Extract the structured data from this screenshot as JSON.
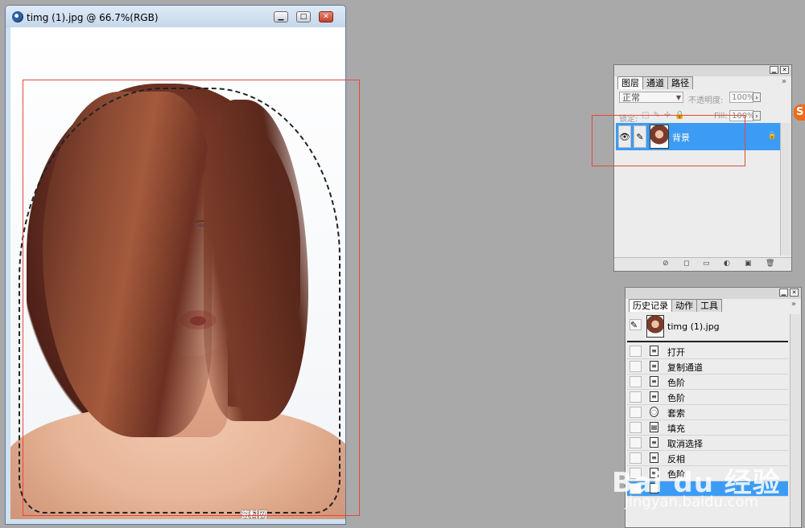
{
  "document": {
    "title": "timg (1).jpg @ 66.7%(RGB)",
    "minimize": "▁",
    "maximize": "□",
    "close": "✕",
    "watermark": "资料网 www.jutmg.com"
  },
  "layers_panel": {
    "tabs": [
      "图层",
      "通道",
      "路径"
    ],
    "blend_mode": "正常",
    "opacity_label": "不透明度:",
    "opacity_value": "100%",
    "lock_label": "锁定:",
    "fill_label": "Fill:",
    "fill_value": "100%",
    "layer_name": "背景"
  },
  "history_panel": {
    "tabs": [
      "历史记录",
      "动作",
      "工具"
    ],
    "snapshot": "timg (1).jpg",
    "items": [
      {
        "label": "打开",
        "icon": "doc-icon"
      },
      {
        "label": "复制通道",
        "icon": "doc-icon"
      },
      {
        "label": "色阶",
        "icon": "doc-icon"
      },
      {
        "label": "色阶",
        "icon": "doc-icon"
      },
      {
        "label": "套索",
        "icon": "lasso-icon"
      },
      {
        "label": "填充",
        "icon": "fill-icon"
      },
      {
        "label": "取消选择",
        "icon": "doc-icon"
      },
      {
        "label": "反相",
        "icon": "doc-icon"
      },
      {
        "label": "色阶",
        "icon": "doc-icon"
      },
      {
        "label": "",
        "icon": "doc-icon",
        "active": true
      }
    ]
  },
  "overlay": {
    "baidu": "Bai du 经验",
    "site": "jingyan.baidu.com",
    "badge": "S"
  },
  "colors": {
    "accent": "#3c9cf5",
    "annotation": "#e04a3a"
  }
}
